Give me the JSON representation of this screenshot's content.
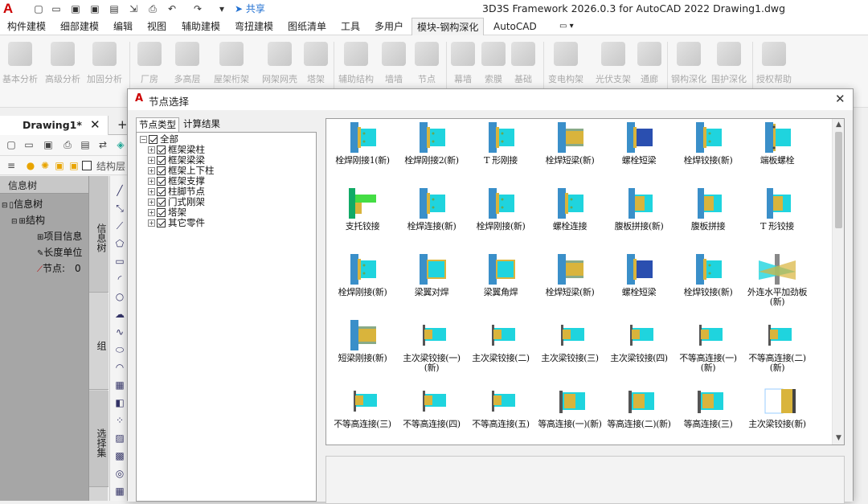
{
  "titlebar": {
    "app_logo": "A",
    "share_label": "共享",
    "window_title": "3D3S Framework 2026.0.3 for AutoCAD 2022    Drawing1.dwg"
  },
  "menu": [
    "构件建模",
    "细部建模",
    "编辑",
    "视图",
    "辅助建模",
    "弯扭建模",
    "图纸清单",
    "工具",
    "多用户",
    "模块-钢构深化",
    "AutoCAD"
  ],
  "ribbon": [
    "基本分析",
    "高级分析",
    "加固分析",
    "厂房",
    "多高层",
    "屋架桁架",
    "网架网壳",
    "塔架",
    "辅助结构",
    "墙墙",
    "节点",
    "幕墙",
    "索膜",
    "基础",
    "变电构架",
    "光伏支架",
    "通廊",
    "钢构深化",
    "围护深化",
    "授权帮助"
  ],
  "doc_tab": {
    "label": "Drawing1*",
    "close": "✕"
  },
  "toolbar2": {
    "layer_label": "结构层"
  },
  "left_panel": {
    "header": "信息树",
    "tree": [
      {
        "label": "信息树"
      },
      {
        "label": "结构"
      },
      {
        "label": "项目信息"
      },
      {
        "label": "长度单位"
      },
      {
        "label": "节点:",
        "value": "0"
      }
    ]
  },
  "side_tabs": [
    "信息树",
    "组",
    "选择集"
  ],
  "dialog": {
    "logo": "A",
    "title": "节点选择",
    "close": "✕",
    "tabs": [
      "节点类型",
      "计算结果"
    ],
    "tree": [
      "全部",
      "框架梁柱",
      "框架梁梁",
      "框架上下柱",
      "框架支撑",
      "柱脚节点",
      "门式刚架",
      "塔架",
      "其它零件"
    ],
    "nodes": [
      {
        "label": "栓焊刚接1(新)",
        "icon": "column-beam"
      },
      {
        "label": "栓焊刚接2(新)",
        "icon": "column-beam"
      },
      {
        "label": "T 形刚接",
        "icon": "column-beam"
      },
      {
        "label": "栓焊短梁(新)",
        "icon": "short-beam"
      },
      {
        "label": "螺栓短梁",
        "icon": "short-beam-blue"
      },
      {
        "label": "栓焊铰接(新)",
        "icon": "column-beam"
      },
      {
        "label": "端板螺栓",
        "icon": "end-plate"
      },
      {
        "label": "支托铰接",
        "icon": "bracket"
      },
      {
        "label": "栓焊连接(新)",
        "icon": "column-beam"
      },
      {
        "label": "栓焊刚接(新)",
        "icon": "column-beam"
      },
      {
        "label": "螺栓连接",
        "icon": "column-beam"
      },
      {
        "label": "腹板拼接(新)",
        "icon": "web-splice"
      },
      {
        "label": "腹板拼接",
        "icon": "web-splice"
      },
      {
        "label": "T 形铰接",
        "icon": "web-splice"
      },
      {
        "label": "栓焊刚接(新)",
        "icon": "column-beam"
      },
      {
        "label": "梁翼对焊",
        "icon": "flange-weld"
      },
      {
        "label": "梁翼角焊",
        "icon": "flange-weld"
      },
      {
        "label": "栓焊短梁(新)",
        "icon": "short-beam"
      },
      {
        "label": "螺栓短梁",
        "icon": "short-beam-blue"
      },
      {
        "label": "栓焊铰接(新)",
        "icon": "column-beam"
      },
      {
        "label": "外连水平加劲板(新)",
        "icon": "stiffener"
      },
      {
        "label": "短梁刚接(新)",
        "icon": "short-beam"
      },
      {
        "label": "主次梁铰接(一)(新)",
        "icon": "girder"
      },
      {
        "label": "主次梁铰接(二)",
        "icon": "girder"
      },
      {
        "label": "主次梁铰接(三)",
        "icon": "girder"
      },
      {
        "label": "主次梁铰接(四)",
        "icon": "girder"
      },
      {
        "label": "不等高连接(一)(新)",
        "icon": "girder"
      },
      {
        "label": "不等高连接(二)(新)",
        "icon": "girder"
      },
      {
        "label": "不等高连接(三)",
        "icon": "girder"
      },
      {
        "label": "不等高连接(四)",
        "icon": "girder"
      },
      {
        "label": "不等高连接(五)",
        "icon": "girder"
      },
      {
        "label": "等高连接(一)(新)",
        "icon": "girder-yellow"
      },
      {
        "label": "等高连接(二)(新)",
        "icon": "girder-yellow"
      },
      {
        "label": "等高连接(三)",
        "icon": "girder-yellow"
      },
      {
        "label": "主次梁铰接(新)",
        "icon": "girder-end"
      }
    ]
  },
  "colors": {
    "accent": "#2e8bc0",
    "teal": "#1fd4de",
    "yellow": "#d9b43c",
    "column": "#3a8fc9"
  }
}
